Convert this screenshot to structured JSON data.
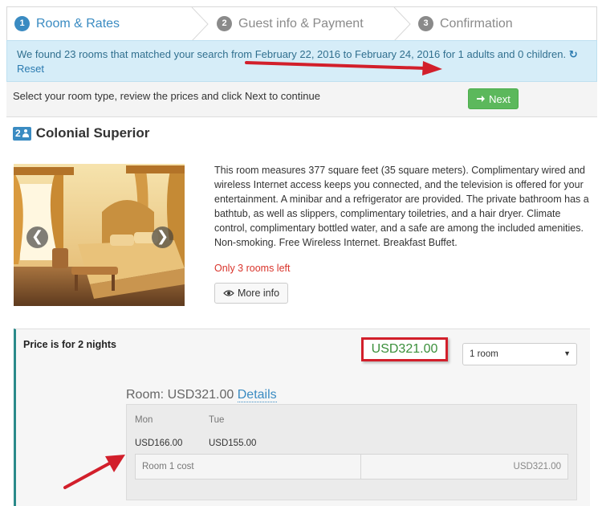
{
  "steps": [
    {
      "number": "1",
      "label": "Room & Rates"
    },
    {
      "number": "2",
      "label": "Guest info & Payment"
    },
    {
      "number": "3",
      "label": "Confirmation"
    }
  ],
  "banner": {
    "message": "We found 23 rooms that matched your search from February 22, 2016 to February 24, 2016 for 1 adults and 0 children.",
    "refresh_icon": "↻",
    "reset_label": "Reset"
  },
  "instruction": {
    "text": "Select your room type, review the prices and click Next to continue",
    "next_label": "Next"
  },
  "room": {
    "occupancy": "2",
    "name": "Colonial Superior",
    "description": "This room measures 377 square feet (35 square meters). Complimentary wired and wireless Internet access keeps you connected, and the television is offered for your entertainment. A minibar and a refrigerator are provided. The private bathroom has a bathtub, as well as slippers, complimentary toiletries, and a hair dryer. Climate control, complimentary bottled water, and a safe are among the included amenities. Non-smoking. Free Wireless Internet. Breakfast Buffet.",
    "rooms_left": "Only 3 rooms left",
    "more_info_label": "More info",
    "prev_glyph": "❮",
    "next_glyph": "❯"
  },
  "pricing": {
    "price_for": "Price is for 2 nights",
    "total": "USD321.00",
    "room_select_value": "1 room",
    "breakdown_prefix": "Room: USD321.00",
    "details_label": "Details",
    "days": [
      {
        "day": "Mon",
        "amount": "USD166.00"
      },
      {
        "day": "Tue",
        "amount": "USD155.00"
      }
    ],
    "cost_label": "Room 1 cost",
    "cost_value": "USD321.00"
  },
  "colors": {
    "accent_blue": "#3a8bc2",
    "banner_bg": "#d6edf8",
    "next_green": "#5cb85c",
    "alert_red": "#d9342b",
    "annotation_red": "#d21f2b",
    "price_green": "#3a8f3a",
    "panel_border_teal": "#2a8a8a"
  },
  "icons": {
    "refresh": "refresh-icon",
    "next_arrow": "arrow-right-icon",
    "eye": "eye-icon",
    "occupancy": "person-icon",
    "carousel_prev": "chevron-left-icon",
    "carousel_next": "chevron-right-icon",
    "select_caret": "caret-down-icon"
  }
}
